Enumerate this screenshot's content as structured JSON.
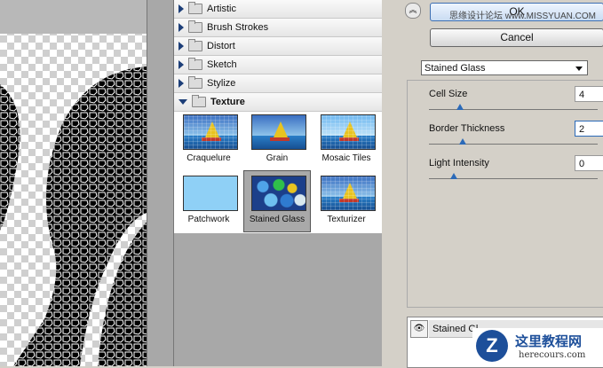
{
  "gallery": {
    "categories": [
      {
        "label": "Artistic",
        "expanded": false
      },
      {
        "label": "Brush Strokes",
        "expanded": false
      },
      {
        "label": "Distort",
        "expanded": false
      },
      {
        "label": "Sketch",
        "expanded": false
      },
      {
        "label": "Stylize",
        "expanded": false
      },
      {
        "label": "Texture",
        "expanded": true
      }
    ],
    "filters": [
      {
        "label": "Craquelure",
        "selected": false
      },
      {
        "label": "Grain",
        "selected": false
      },
      {
        "label": "Mosaic Tiles",
        "selected": false
      },
      {
        "label": "Patchwork",
        "selected": false
      },
      {
        "label": "Stained Glass",
        "selected": true
      },
      {
        "label": "Texturizer",
        "selected": false
      }
    ]
  },
  "dialog": {
    "collapse_icon": "chevron-up-icon",
    "ok_label": "OK",
    "cancel_label": "Cancel",
    "filter_select_value": "Stained Glass",
    "params": [
      {
        "label": "Cell Size",
        "value": "4"
      },
      {
        "label": "Border Thickness",
        "value": "2"
      },
      {
        "label": "Light Intensity",
        "value": "0"
      }
    ],
    "layer_name": "Stained Gl"
  },
  "watermark": {
    "top_text": "思缘设计论坛  www.MISSYUAN.COM",
    "logo_letter": "Z",
    "logo_title": "这里教程网",
    "logo_url": "herecours.com"
  },
  "colors": {
    "accent": "#2b6ab8",
    "logo_blue": "#1d4f9a"
  }
}
